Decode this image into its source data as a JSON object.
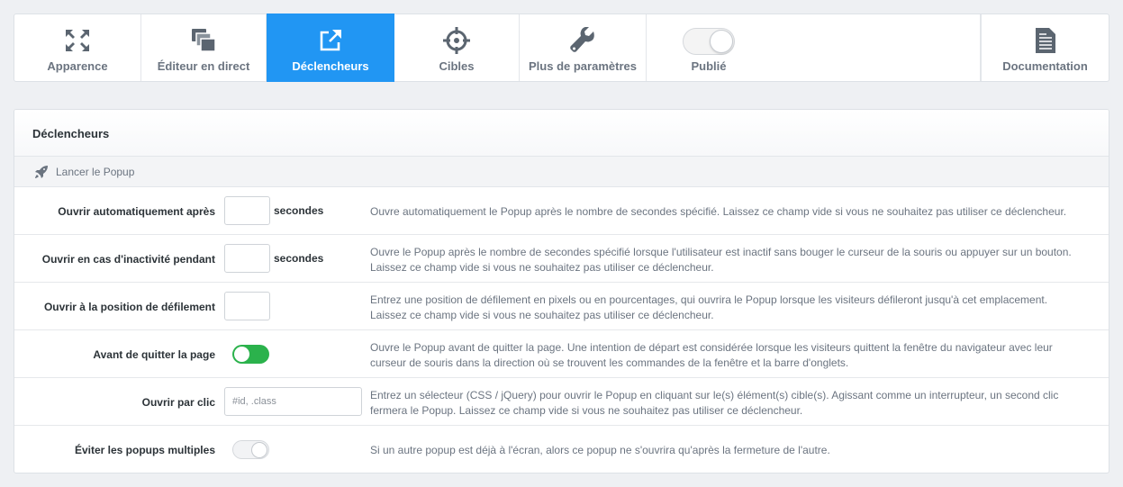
{
  "tabs": [
    {
      "label": "Apparence",
      "icon": "expand-icon"
    },
    {
      "label": "Éditeur en direct",
      "icon": "live-editor-icon"
    },
    {
      "label": "Déclencheurs",
      "icon": "external-link-icon"
    },
    {
      "label": "Cibles",
      "icon": "crosshair-icon"
    },
    {
      "label": "Plus de paramètres",
      "icon": "wrench-icon"
    }
  ],
  "active_tab": "Déclencheurs",
  "publish": {
    "label": "Publié",
    "enabled": false
  },
  "documentation": {
    "label": "Documentation",
    "icon": "document-icon"
  },
  "panel": {
    "title": "Déclencheurs",
    "section": {
      "label": "Lancer le Popup",
      "icon": "rocket-icon"
    },
    "rows": [
      {
        "label": "Ouvrir automatiquement après",
        "value": "",
        "unit": "secondes",
        "desc1": "Ouvre automatiquement le Popup après le nombre de secondes spécifié. Laissez ce champ vide si vous ne souhaitez pas utiliser ce déclencheur.",
        "desc2": ""
      },
      {
        "label": "Ouvrir en cas d'inactivité pendant",
        "value": "",
        "unit": "secondes",
        "desc1": "Ouvre le Popup après le nombre de secondes spécifié lorsque l'utilisateur est inactif sans bouger le curseur de la souris ou appuyer sur un bouton.",
        "desc2": "Laissez ce champ vide si vous ne souhaitez pas utiliser ce déclencheur."
      },
      {
        "label": "Ouvrir à la position de défilement",
        "value": "",
        "desc1": "Entrez une position de défilement en pixels ou en pourcentages, qui ouvrira le Popup lorsque les visiteurs défileront jusqu'à cet emplacement.",
        "desc2": "Laissez ce champ vide si vous ne souhaitez pas utiliser ce déclencheur."
      },
      {
        "label": "Avant de quitter la page",
        "enabled": true,
        "desc1": "Ouvre le Popup avant de quitter la page. Une intention de départ est considérée lorsque les visiteurs quittent la fenêtre du navigateur avec leur",
        "desc2": "curseur de souris dans la direction où se trouvent les commandes de la fenêtre et la barre d'onglets."
      },
      {
        "label": "Ouvrir par clic",
        "value": "",
        "placeholder": "#id, .class",
        "desc1": "Entrez un sélecteur (CSS / jQuery) pour ouvrir le Popup en cliquant sur le(s) élément(s) cible(s). Agissant comme un interrupteur, un second clic",
        "desc2": "fermera le Popup. Laissez ce champ vide si vous ne souhaitez pas utiliser ce déclencheur."
      },
      {
        "label": "Éviter les popups multiples",
        "enabled": false,
        "desc1": "Si un autre popup est déjà à l'écran, alors ce popup ne s'ouvrira qu'après la fermeture de l'autre.",
        "desc2": ""
      }
    ]
  },
  "colors": {
    "accent": "#2196f3",
    "toggle_on": "#2bb24c",
    "muted_text": "#6b7480"
  }
}
